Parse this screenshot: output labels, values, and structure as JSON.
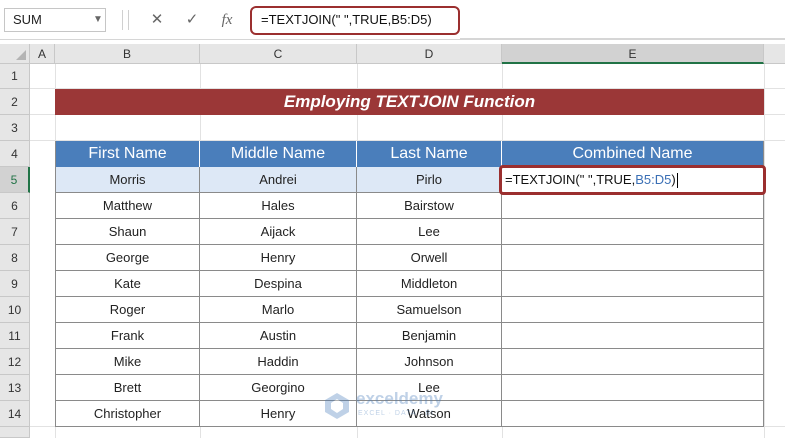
{
  "formula_bar": {
    "name_box": "SUM",
    "cancel_icon": "✕",
    "enter_icon": "✓",
    "fx_icon": "fx",
    "formula": "=TEXTJOIN(\" \",TRUE,B5:D5)"
  },
  "columns": [
    "A",
    "B",
    "C",
    "D",
    "E"
  ],
  "rows": [
    "1",
    "2",
    "3",
    "4",
    "5",
    "6",
    "7",
    "8",
    "9",
    "10",
    "11",
    "12",
    "13",
    "14"
  ],
  "title": "Employing TEXTJOIN Function",
  "table": {
    "headers": [
      "First Name",
      "Middle Name",
      "Last Name",
      "Combined Name"
    ],
    "rows": [
      [
        "Morris",
        "Andrei",
        "Pirlo"
      ],
      [
        "Matthew",
        "Hales",
        "Bairstow"
      ],
      [
        "Shaun",
        "Aijack",
        "Lee"
      ],
      [
        "George",
        "Henry",
        "Orwell"
      ],
      [
        "Kate",
        "Despina",
        "Middleton"
      ],
      [
        "Roger",
        "Marlo",
        "Samuelson"
      ],
      [
        "Frank",
        "Austin",
        "Benjamin"
      ],
      [
        "Mike",
        "Haddin",
        "Johnson"
      ],
      [
        "Brett",
        "Georgino",
        "Lee"
      ],
      [
        "Christopher",
        "Henry",
        "Watson"
      ]
    ]
  },
  "active_cell": {
    "text_prefix": "=TEXTJOIN(\" \",TRUE,",
    "text_ref": "B5:D5",
    "text_suffix": ")"
  },
  "watermark": {
    "name": "exceldemy",
    "tagline": "EXCEL · DATA · BI"
  },
  "colors": {
    "title_bg": "#9b3737",
    "header_bg": "#4a7ebb",
    "highlight_border": "#9b2f2f",
    "selected_row": "#dde8f6"
  }
}
